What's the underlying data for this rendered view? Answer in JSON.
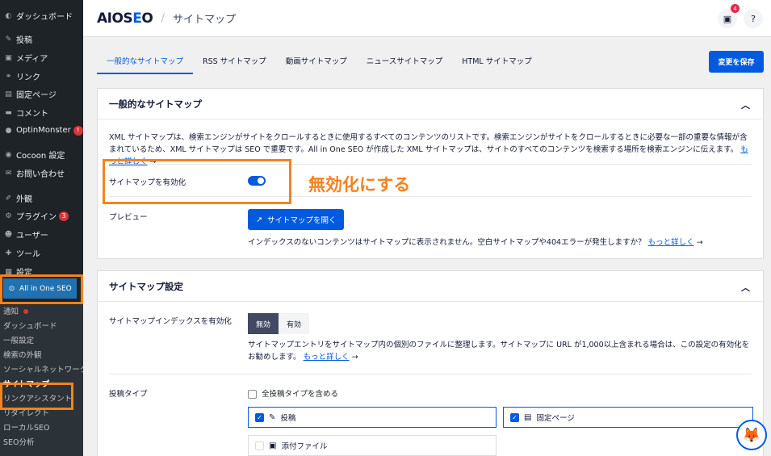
{
  "sidebar": {
    "items": [
      {
        "icon": "dashboard-icon",
        "glyph": "◐",
        "label": "ダッシュボード"
      },
      {
        "icon": "pin-icon",
        "glyph": "✎",
        "label": "投稿"
      },
      {
        "icon": "media-icon",
        "glyph": "▣",
        "label": "メディア"
      },
      {
        "icon": "link-icon",
        "glyph": "⚭",
        "label": "リンク"
      },
      {
        "icon": "page-icon",
        "glyph": "▤",
        "label": "固定ページ"
      },
      {
        "icon": "comment-icon",
        "glyph": "▬",
        "label": "コメント"
      },
      {
        "icon": "optinmonster-icon",
        "glyph": "●",
        "label": "OptinMonster",
        "badge": "!"
      },
      {
        "icon": "cocoon-icon",
        "glyph": "◉",
        "label": "Cocoon 設定"
      },
      {
        "icon": "mail-icon",
        "glyph": "✉",
        "label": "お問い合わせ"
      },
      {
        "icon": "appearance-icon",
        "glyph": "✐",
        "label": "外観"
      },
      {
        "icon": "plugin-icon",
        "glyph": "⚙",
        "label": "プラグイン",
        "badge": "3"
      },
      {
        "icon": "user-icon",
        "glyph": "☻",
        "label": "ユーザー"
      },
      {
        "icon": "tool-icon",
        "glyph": "✚",
        "label": "ツール"
      },
      {
        "icon": "settings-icon",
        "glyph": "▦",
        "label": "設定"
      }
    ],
    "aioseo_label": "All in One SEO",
    "submenu": [
      "通知",
      "ダッシュボード",
      "一般設定",
      "検索の外観",
      "ソーシャルネットワーク",
      "サイトマップ",
      "リンクアシスタント",
      "リダイレクト",
      "ローカルSEO",
      "SEO分析"
    ]
  },
  "header": {
    "logo_prefix": "AIOS",
    "logo_accent": "E",
    "logo_suffix": "O",
    "page_title": "サイトマップ",
    "notifications_count": "4",
    "inbox_icon": "inbox-icon",
    "help_icon": "help-icon"
  },
  "tabs": [
    "一般的なサイトマップ",
    "RSS サイトマップ",
    "動画サイトマップ",
    "ニュースサイトマップ",
    "HTML サイトマップ"
  ],
  "save_label": "変更を保存",
  "general_card": {
    "title": "一般的なサイトマップ",
    "description": "XML サイトマップは、検索エンジンがサイトをクロールするときに使用するすべてのコンテンツのリストです。検索エンジンがサイトをクロールするときに必要な一部の重要な情報が含まれているため、XML サイトマップは SEO で重要です。All in One SEO が作成した XML サイトマップは、サイトのすべてのコンテンツを検索する場所を検索エンジンに伝えます。",
    "learn_more": "もっと詳しく",
    "enable_label": "サイトマップを有効化",
    "enabled": true,
    "preview_label": "プレビュー",
    "open_button": "サイトマップを開く",
    "note": "インデックスのないコンテンツはサイトマップに表示されません。空白サイトマップや404エラーが発生しますか？",
    "note_link": "もっと詳しく"
  },
  "annotation": "無効化にする",
  "settings_card": {
    "title": "サイトマップ設定",
    "index_label": "サイトマップインデックスを有効化",
    "seg_off": "無効",
    "seg_on": "有効",
    "index_desc": "サイトマップエントリをサイトマップ内の個別のファイルに整理します。サイトマップに URL が1,000以上含まれる場合は、この設定の有効化をお勧めします。",
    "index_link": "もっと詳しく",
    "post_types_label": "投稿タイプ",
    "include_all": "全投稿タイプを含める",
    "post_types": [
      {
        "label": "投稿",
        "checked": true
      },
      {
        "label": "固定ページ",
        "checked": true
      },
      {
        "label": "添付ファイル",
        "checked": false
      }
    ]
  },
  "colors": {
    "accent": "#005ae0",
    "highlight": "#f5821f"
  }
}
